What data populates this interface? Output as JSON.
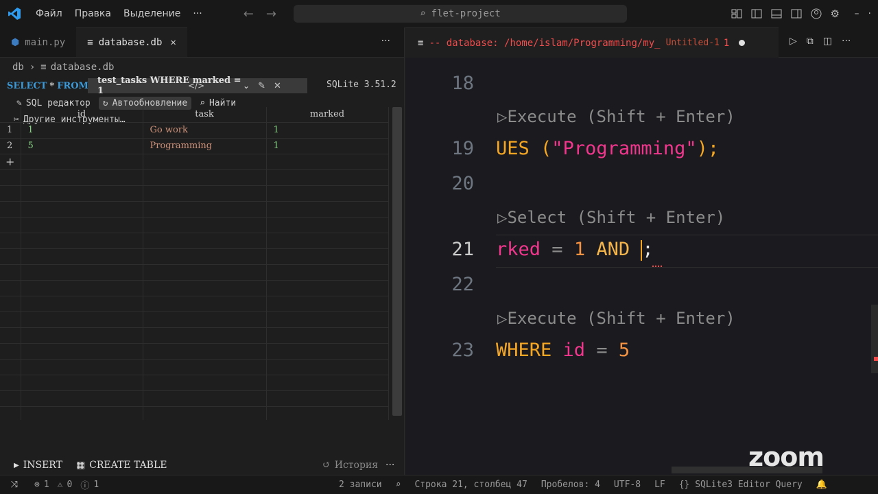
{
  "titlebar": {
    "menu": [
      "Файл",
      "Правка",
      "Выделение"
    ],
    "more": "···",
    "search_text": "flet-project"
  },
  "left": {
    "tabs": [
      {
        "label": "main.py",
        "active": false
      },
      {
        "label": "database.db",
        "active": true
      }
    ],
    "tabs_more": "···",
    "breadcrumb": [
      "db",
      "database.db"
    ],
    "query": {
      "kw_select": "SELECT",
      "star": "*",
      "kw_from": "FROM",
      "table_value": "test_tasks WHERE marked = 1",
      "sqlite_version": "SQLite 3.51.2"
    },
    "tools": {
      "sql_editor": "SQL редактор",
      "autoupdate": "Автообновление",
      "find": "Найти",
      "other_tools": "Другие инструменты…"
    },
    "grid": {
      "columns": [
        "id",
        "task",
        "marked"
      ],
      "rows": [
        {
          "n": "1",
          "id": "1",
          "task": "Go work",
          "marked": "1"
        },
        {
          "n": "2",
          "id": "5",
          "task": "Programming",
          "marked": "1"
        }
      ],
      "add_symbol": "+"
    },
    "footer": {
      "insert": "INSERT",
      "create_table": "CREATE TABLE",
      "history": "История",
      "more": "···"
    }
  },
  "right": {
    "tab": {
      "title": "-- database: /home/islam/Programming/my_",
      "subtitle": "Untitled-1",
      "count": "1"
    },
    "lines": {
      "l18": "18",
      "lens_execute_1": "▷Execute (Shift + Enter)",
      "l19": "19",
      "l19_a": "UES (",
      "l19_str": "\"Programming\"",
      "l19_b": ");",
      "l20": "20",
      "lens_select": "▷Select (Shift + Enter)",
      "l21": "21",
      "l21_id": "rked",
      "l21_eq": " = ",
      "l21_num": "1",
      "l21_and": " AND ",
      "l21_end": ";",
      "l22": "22",
      "lens_execute_2": "▷Execute (Shift + Enter)",
      "l23": "23",
      "l23_kw": "WHERE",
      "l23_id": " id",
      "l23_eq": " = ",
      "l23_num": "5"
    },
    "zoom_logo": "zoom"
  },
  "statusbar": {
    "errors": "1",
    "warnings": "0",
    "info": "1",
    "records": "2 записи",
    "position": "Строка 21, столбец 47",
    "spaces": "Пробелов: 4",
    "encoding": "UTF-8",
    "eol": "LF",
    "language": "SQLite3 Editor Query"
  }
}
